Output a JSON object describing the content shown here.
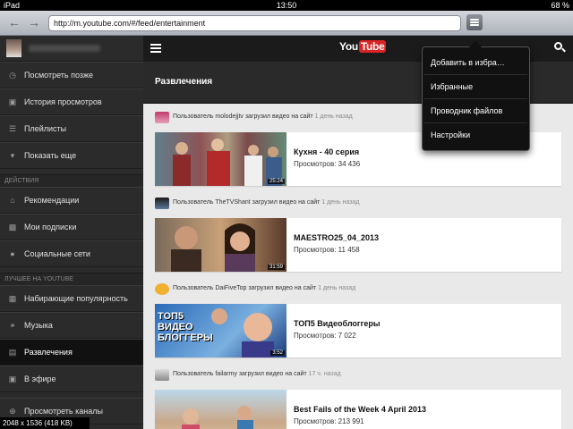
{
  "status": {
    "device": "iPad",
    "time": "13:50",
    "battery": "68 %"
  },
  "browser": {
    "url": "http://m.youtube.com/#/feed/entertainment"
  },
  "sidebar": {
    "items_top": [
      {
        "label": "Посмотреть позже",
        "icon": "clock-icon"
      },
      {
        "label": "История просмотров",
        "icon": "history-icon"
      },
      {
        "label": "Плейлисты",
        "icon": "playlist-icon"
      },
      {
        "label": "Показать еще",
        "icon": "chevron-down-icon"
      }
    ],
    "section_actions": "ДЕЙСТВИЯ",
    "items_actions": [
      {
        "label": "Рекомендации",
        "icon": "home-icon"
      },
      {
        "label": "Мои подписки",
        "icon": "subscriptions-icon"
      },
      {
        "label": "Социальные сети",
        "icon": "social-icon"
      }
    ],
    "section_best": "ЛУЧШЕЕ НА YOUTUBE",
    "items_best": [
      {
        "label": "Набирающие популярность",
        "icon": "trending-icon"
      },
      {
        "label": "Музыка",
        "icon": "headphones-icon"
      },
      {
        "label": "Развлечения",
        "icon": "entertainment-icon"
      },
      {
        "label": "В эфире",
        "icon": "live-icon"
      },
      {
        "label": "Просмотреть каналы",
        "icon": "plus-icon"
      }
    ]
  },
  "header": {
    "logo_you": "You",
    "logo_tube": "Tube"
  },
  "main": {
    "section_title": "Развлечения",
    "feed": [
      {
        "user": "molodejjtv",
        "action": "Пользователь molodejjtv загрузил видео на сайт",
        "ago": "1 день назад",
        "title": "Кухня - 40 серия",
        "views": "Просмотров: 34 436",
        "duration": "25:24"
      },
      {
        "user": "TheTVShant",
        "action": "Пользователь TheTVShant загрузил видео на сайт",
        "ago": "1 день назад",
        "title": "MAESTRO25_04_2013",
        "views": "Просмотров: 11 458",
        "duration": "31:59"
      },
      {
        "user": "DaiFiveTop",
        "action": "Пользователь DaiFiveTop загрузил видео на сайт",
        "ago": "1 день назад",
        "title": "ТОП5 Видеоблоггеры",
        "views": "Просмотров: 7 022",
        "duration": "3:52",
        "thumb_text": "ТОП5 ВИДЕО БЛОГГЕРЫ"
      },
      {
        "user": "failarmy",
        "action": "Пользователь failarmy загрузил видео на сайт",
        "ago": "17 ч. назад",
        "title": "Best Fails of the Week 4 April 2013",
        "views": "Просмотров: 213 991",
        "duration": ""
      }
    ]
  },
  "popover": {
    "items": [
      "Добавить в избра…",
      "Избранные",
      "Проводник файлов",
      "Настройки"
    ]
  },
  "image_info": "2048 x 1536 (418 KB)"
}
